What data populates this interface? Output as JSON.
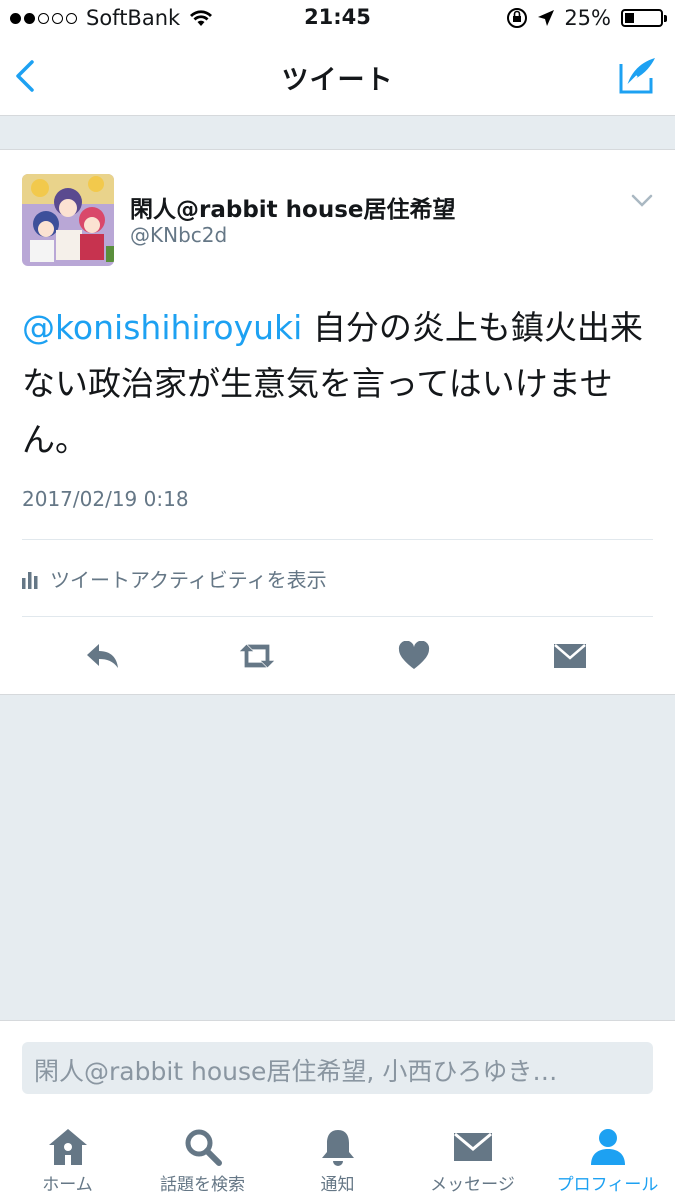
{
  "status_bar": {
    "carrier": "SoftBank",
    "time": "21:45",
    "battery_text": "25%",
    "battery_level": 0.25
  },
  "nav": {
    "title": "ツイート"
  },
  "tweet": {
    "display_name": "閑人@rabbit house居住希望",
    "handle": "@KNbc2d",
    "mention": "@konishihiroyuki",
    "body": " 自分の炎上も鎮火出来ない政治家が生意気を言ってはいけません。",
    "timestamp": "2017/02/19 0:18",
    "activity_label": "ツイートアクティビティを表示"
  },
  "reply": {
    "placeholder": "閑人@rabbit house居住希望, 小西ひろゆき…"
  },
  "tabs": [
    {
      "label": "ホーム",
      "icon": "home-icon"
    },
    {
      "label": "話題を検索",
      "icon": "search-icon"
    },
    {
      "label": "通知",
      "icon": "bell-icon"
    },
    {
      "label": "メッセージ",
      "icon": "envelope-icon"
    },
    {
      "label": "プロフィール",
      "icon": "person-icon",
      "active": true
    }
  ],
  "colors": {
    "accent": "#1da1f2",
    "icon_gray": "#657786",
    "background": "#e6ecf0"
  }
}
